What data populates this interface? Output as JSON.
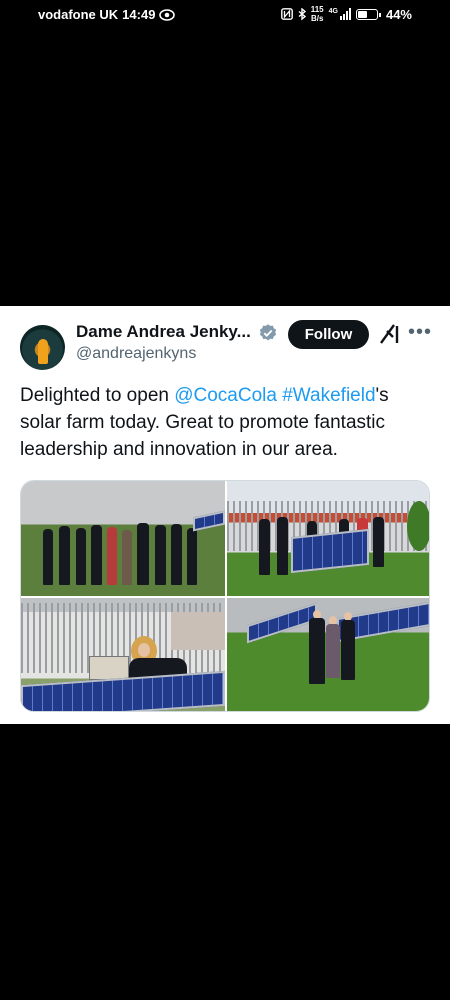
{
  "status_bar": {
    "carrier": "vodafone UK",
    "time": "14:49",
    "speed_top": "115",
    "speed_bottom": "B/s",
    "network": "4G",
    "battery": "44%"
  },
  "tweet": {
    "author_name": "Dame Andrea Jenky...",
    "handle": "@andreajenkyns",
    "follow_label": "Follow",
    "more_label": "•••",
    "text_before": "Delighted to open ",
    "mention": "@CocaCola",
    "hashtag": "#Wakefield",
    "text_after": "'s solar farm today. Great to promote fantastic leadership and innovation in our area."
  },
  "icons": {
    "verified": "verified-badge-icon",
    "grok": "grok-icon",
    "more": "more-options-icon"
  },
  "colors": {
    "link": "#1d9bf0",
    "follow_bg": "#0f1419",
    "handle_gray": "#536471"
  }
}
